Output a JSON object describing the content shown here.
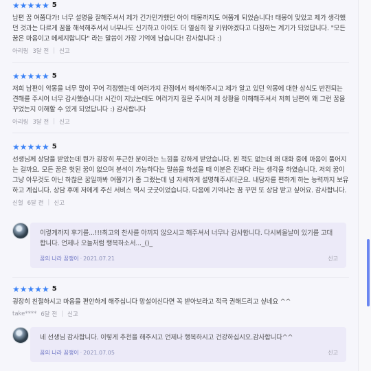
{
  "reviews": [
    {
      "stars": "★★★★★",
      "score": "5",
      "text": "남편 꿈 여쭙다가! 너무 설명을 잘해주셔서 제가 긴가민가했던 아이 태몽까지도 여쭙게 되었습니다! 태몽이 맞았고 제가 생각했던 것과는 다르게 꿈을 해석해주셔서 너무나도 신기하고 아이도 더 열심히 잘 키워야겠다고 다짐하는 계기가 되었답니다. \"모든 꿈은 마음이고 메세지랍니다\" 라는 말씀이 가장 기억에 남습니다! 감사합니다 :)",
      "author": "아리링",
      "time": "3달 전",
      "report": "신고"
    },
    {
      "stars": "★★★★★",
      "score": "5",
      "text": "저희 남편이 악몽을 너무 많이 꾸어 걱정했는데 여러가지 관점에서 해석해주시고 제가 알고 있던 악몽에 대한 상식도 반전되는 견해를 주시어 너무 감사했습니다! 시간이 지났는데도 여러가지 질문 주시며 제 상황을 이해해주셔서 저희 남편이 왜 그런 꿈을 꾸었는지 이해할 수 있게 되었답니다 :) 감사합니다",
      "author": "아리링",
      "time": "3달 전",
      "report": "신고"
    },
    {
      "stars": "★★★★★",
      "score": "5",
      "text": "선생님께 상담을 받았는데 뭔가 굉장히 푸근한 분이라는 느낌을 강하게 받았습니다. 뵌 적도 없는데 왜 대화 중에 마음이 풀어지는 걸까요. 모든 꿈은 헛된 꿈이 없으며 분석이 가능하다는 말씀을 하셨을 때 이분은 진짜다 라는 생각을 하였습니다. 저의 꿈이 그냥 아무것도 아닌 하찮은 꿈일까봐 여쭙기가 좀 그랬는데 넘 자세하게 설명해주시더군요. 내담자를 편하게 하는 능력까지 보유하고 계십니다. 상담 후에 저에게 주신 서비스 역시 굿굿이었습니다. 다음에 기억나는 꿈 꾸면 또 상담 받고 싶어요. 감사합니다.",
      "author": "신헐",
      "time": "6달 전",
      "report": "신고",
      "reply": {
        "text": "이렇게까지 후기를...!!!최고의 찬사를 아끼지 않으시고 해주셔서 너무나 감사합니다. 다시뵈올날이 있기를 고대합니다. 언제나 오늘처럼 행복하소서..._()_",
        "author": "꿈의 나라 꿈쟁이",
        "date": "2021.07.21",
        "report": "신고"
      }
    },
    {
      "stars": "★★★★★",
      "score": "5",
      "text": "굉장히 친절하시고 마음을 편안하게 해주십니다 망설이신다면 꼭 받아보라고 적극 권해드리고 싶네요 ^^",
      "author": "take****",
      "time": "6달 전",
      "report": "신고",
      "reply": {
        "text": "네 선생님 감사합니다. 이렇게 추천을 해주시고 언제나 행복하시고 건강하십시오.감사합니다^^",
        "author": "꿈의 나라 꿈쟁이",
        "date": "2021.07.05",
        "report": "신고"
      }
    }
  ]
}
